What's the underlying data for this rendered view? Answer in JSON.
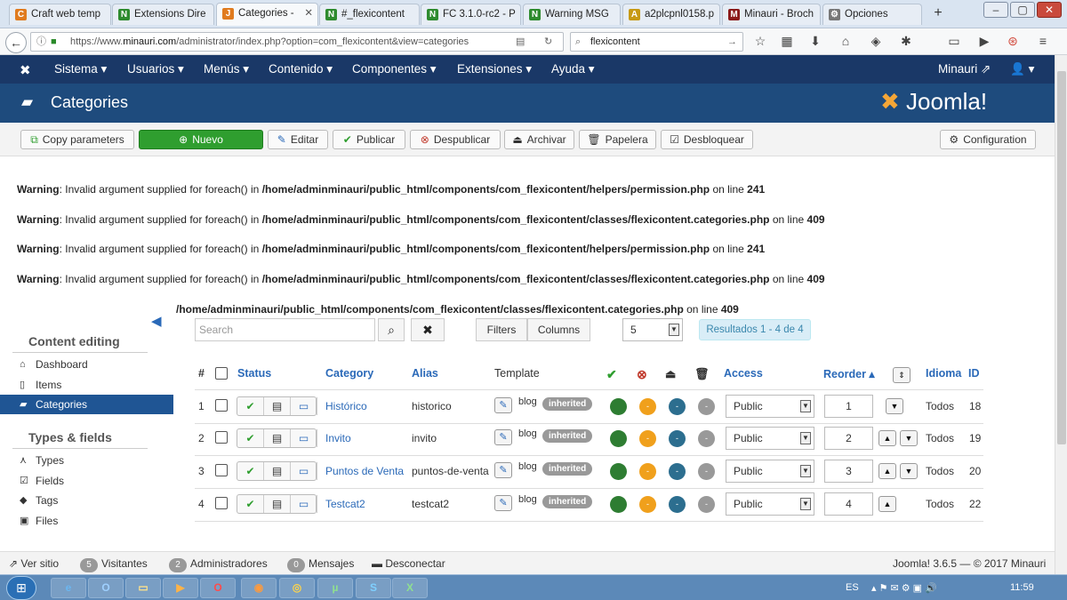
{
  "browser": {
    "tabs": [
      {
        "label": "Craft web temp",
        "fav_color": "#e07b1e",
        "fav_glyph": "C",
        "active": false
      },
      {
        "label": "Extensions Dire",
        "fav_color": "#2e8b2e",
        "fav_glyph": "N",
        "active": false
      },
      {
        "label": "Categories -",
        "fav_color": "#e07b1e",
        "fav_glyph": "J",
        "active": true
      },
      {
        "label": "#_flexicontent",
        "fav_color": "#2e8b2e",
        "fav_glyph": "N",
        "active": false
      },
      {
        "label": "FC 3.1.0-rc2 - P",
        "fav_color": "#2e8b2e",
        "fav_glyph": "N",
        "active": false
      },
      {
        "label": "Warning MSG",
        "fav_color": "#2e8b2e",
        "fav_glyph": "N",
        "active": false
      },
      {
        "label": "a2plcpnl0158.p",
        "fav_color": "#c79a14",
        "fav_glyph": "A",
        "active": false
      },
      {
        "label": "Minauri - Broch",
        "fav_color": "#8b1a1a",
        "fav_glyph": "M",
        "active": false
      },
      {
        "label": "Opciones",
        "fav_color": "#777777",
        "fav_glyph": "⚙",
        "active": false
      }
    ],
    "url_prefix": "https://www.",
    "url_host": "minauri.com",
    "url_path": "/administrator/index.php?option=com_flexicontent&view=categories",
    "search_value": "flexicontent"
  },
  "topnav": {
    "items": [
      "Sistema ▾",
      "Usuarios ▾",
      "Menús ▾",
      "Contenido ▾",
      "Componentes ▾",
      "Extensiones ▾",
      "Ayuda ▾"
    ],
    "user": "Minauri",
    "user_menu": "▾"
  },
  "header": {
    "title": "Categories",
    "brand": "Joomla!"
  },
  "toolbar": {
    "copy_parameters": "Copy parameters",
    "nuevo": "Nuevo",
    "editar": "Editar",
    "publicar": "Publicar",
    "despublicar": "Despublicar",
    "archivar": "Archivar",
    "papelera": "Papelera",
    "desbloquear": "Desbloquear",
    "configuration": "Configuration"
  },
  "warnings": [
    {
      "label": "Warning",
      "text": ": Invalid argument supplied for foreach() in ",
      "path": "/home/adminminauri/public_html/components/com_flexicontent/helpers/permission.php",
      "line_text": " on line ",
      "line": "241"
    },
    {
      "label": "Warning",
      "text": ": Invalid argument supplied for foreach() in ",
      "path": "/home/adminminauri/public_html/components/com_flexicontent/classes/flexicontent.categories.php",
      "line_text": " on line ",
      "line": "409"
    },
    {
      "label": "Warning",
      "text": ": Invalid argument supplied for foreach() in ",
      "path": "/home/adminminauri/public_html/components/com_flexicontent/helpers/permission.php",
      "line_text": " on line ",
      "line": "241"
    },
    {
      "label": "Warning",
      "text": ": Invalid argument supplied for foreach() in ",
      "path": "/home/adminminauri/public_html/components/com_flexicontent/classes/flexicontent.categories.php",
      "line_text": " on line ",
      "line": "409"
    },
    {
      "label": "",
      "text": "",
      "path": "/home/adminminauri/public_html/components/com_flexicontent/classes/flexicontent.categories.php",
      "line_text": " on line ",
      "line": "409"
    }
  ],
  "sidebar": {
    "heading_content": "Content editing",
    "heading_types": "Types & fields",
    "items_content": [
      {
        "label": "Dashboard",
        "icon": "home-icon",
        "active": false
      },
      {
        "label": "Items",
        "icon": "document-icon",
        "active": false
      },
      {
        "label": "Categories",
        "icon": "folder-icon",
        "active": true
      }
    ],
    "items_types": [
      {
        "label": "Types",
        "icon": "types-icon",
        "active": false
      },
      {
        "label": "Fields",
        "icon": "checkbox-icon",
        "active": false
      },
      {
        "label": "Tags",
        "icon": "tag-icon",
        "active": false
      },
      {
        "label": "Files",
        "icon": "image-icon",
        "active": false
      }
    ]
  },
  "filters": {
    "search_placeholder": "Search",
    "filters_label": "Filters",
    "columns_label": "Columns",
    "limit": "5",
    "results": "Resultados 1 - 4 de 4"
  },
  "table": {
    "headers": {
      "num": "#",
      "status": "Status",
      "category": "Category",
      "alias": "Alias",
      "template": "Template",
      "access": "Access",
      "reorder": "Reorder ▴",
      "idioma": "Idioma",
      "id": "ID"
    },
    "rows": [
      {
        "num": "1",
        "category": "Histórico",
        "alias": "historico",
        "template": "blog",
        "tag": "inherited",
        "access": "Public",
        "order": "1",
        "idioma": "Todos",
        "id": "18",
        "up": false,
        "down": true
      },
      {
        "num": "2",
        "category": "Invito",
        "alias": "invito",
        "template": "blog",
        "tag": "inherited",
        "access": "Public",
        "order": "2",
        "idioma": "Todos",
        "id": "19",
        "up": true,
        "down": true
      },
      {
        "num": "3",
        "category": "Puntos de Venta",
        "alias": "puntos-de-venta",
        "template": "blog",
        "tag": "inherited",
        "access": "Public",
        "order": "3",
        "idioma": "Todos",
        "id": "20",
        "up": true,
        "down": true
      },
      {
        "num": "4",
        "category": "Testcat2",
        "alias": "testcat2",
        "template": "blog",
        "tag": "inherited",
        "access": "Public",
        "order": "4",
        "idioma": "Todos",
        "id": "22",
        "up": true,
        "down": false
      }
    ]
  },
  "statusbar": {
    "ver_sitio": "Ver sitio",
    "visitantes_count": "5",
    "visitantes": "Visitantes",
    "admins_count": "2",
    "admins": "Administradores",
    "mensajes_count": "0",
    "mensajes": "Mensajes",
    "desconectar": "Desconectar",
    "version": "Joomla! 3.6.5 — © 2017 Minauri"
  },
  "taskbar": {
    "lang": "ES",
    "time": "11:59"
  },
  "colors": {
    "nav": "#1a3867",
    "header": "#1e4b7d",
    "accent": "#2a69b8",
    "success": "#2f9e2f"
  }
}
